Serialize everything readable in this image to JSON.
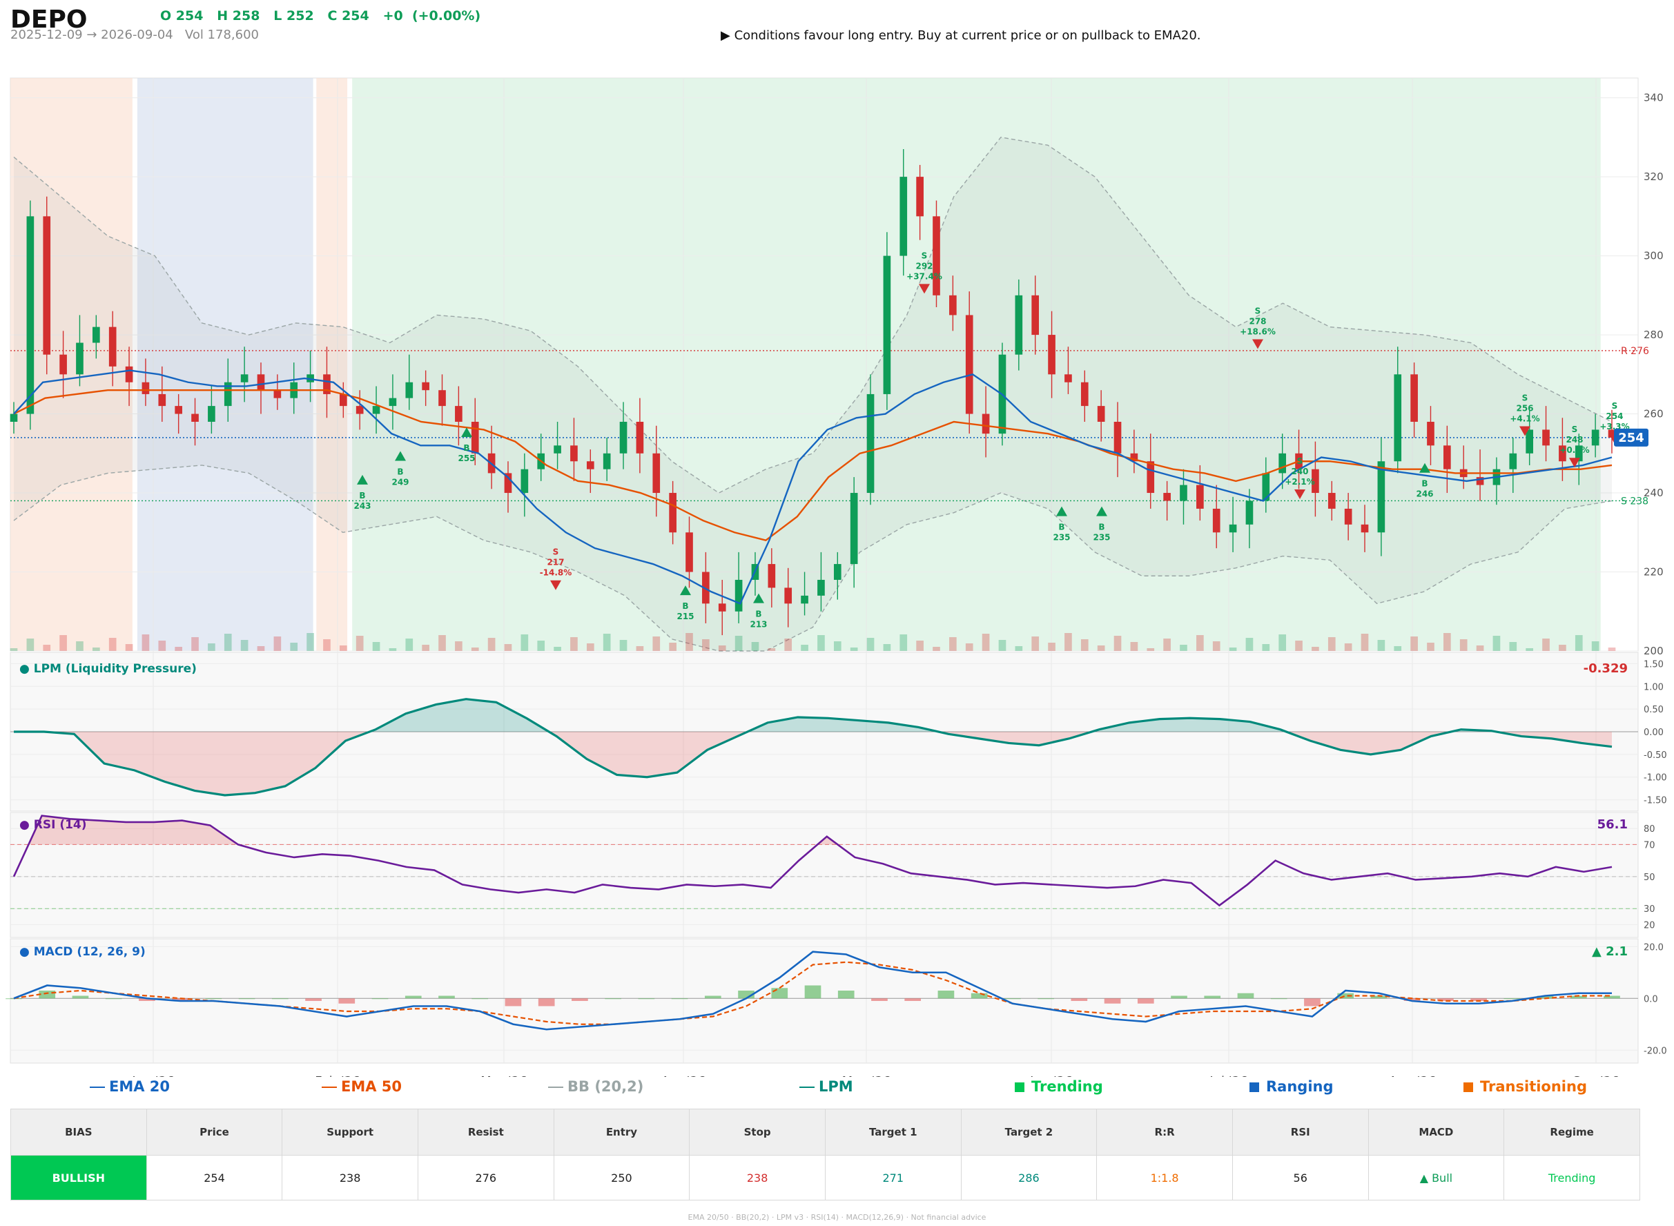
{
  "header": {
    "ticker": "DEPO",
    "ohlc": "O 254   H 258   L 252   C 254   +0  (+0.00%)",
    "range": "2025-12-09 → 2026-09-04   Vol 178,600",
    "note": "▶  Conditions favour long entry. Buy at current price or on pullback to EMA20."
  },
  "colors": {
    "up": "#0f9d58",
    "down": "#d32f2f",
    "ema20": "#1565c0",
    "ema50": "#e65100",
    "bb": "#9aa5a5",
    "lpm": "#00897b",
    "rsi": "#6a1b9a",
    "macd": "#1565c0",
    "signal": "#e65100",
    "trending": "#00c853",
    "ranging": "#1565c0",
    "transitioning": "#ef6c00"
  },
  "chart_data": {
    "type": "line",
    "title": "DEPO",
    "x_start": "2025-12-09",
    "x_end": "2026-09-04",
    "x_ticks": [
      "Jan '26",
      "Feb '26",
      "Mar '26",
      "Apr '26",
      "May '26",
      "Jun '26",
      "Jul '26",
      "Aug '26",
      "Sep '26"
    ],
    "price": {
      "ylim": [
        200,
        345
      ],
      "y_ticks": [
        200,
        220,
        240,
        260,
        280,
        300,
        320,
        340
      ],
      "last": "254",
      "resistance": {
        "value": 276,
        "label": "R 276"
      },
      "support": {
        "value": 238,
        "label": "S 238"
      },
      "price_line": 254,
      "closes": [
        260,
        310,
        275,
        270,
        278,
        282,
        272,
        268,
        265,
        262,
        260,
        258,
        262,
        268,
        270,
        266,
        264,
        268,
        270,
        265,
        262,
        260,
        262,
        264,
        268,
        266,
        262,
        258,
        250,
        245,
        240,
        246,
        250,
        252,
        248,
        246,
        250,
        258,
        250,
        240,
        230,
        220,
        212,
        210,
        218,
        222,
        216,
        212,
        214,
        218,
        222,
        240,
        265,
        300,
        320,
        310,
        290,
        285,
        260,
        255,
        275,
        290,
        280,
        270,
        268,
        262,
        258,
        250,
        248,
        240,
        238,
        242,
        236,
        230,
        232,
        238,
        245,
        250,
        246,
        240,
        236,
        232,
        230,
        248,
        270,
        258,
        252,
        246,
        244,
        242,
        246,
        250,
        256,
        252,
        248,
        252,
        256,
        254
      ],
      "ema20": [
        260,
        268,
        269,
        270,
        271,
        270,
        268,
        267,
        267,
        268,
        269,
        268,
        262,
        255,
        252,
        252,
        250,
        244,
        236,
        230,
        226,
        224,
        222,
        219,
        215,
        212,
        228,
        248,
        256,
        259,
        260,
        265,
        268,
        270,
        265,
        258,
        255,
        252,
        250,
        246,
        244,
        242,
        240,
        238,
        245,
        249,
        248,
        246,
        245,
        244,
        243,
        244,
        245,
        246,
        247,
        249
      ],
      "ema50": [
        260,
        264,
        265,
        266,
        266,
        266,
        266,
        266,
        266,
        266,
        266,
        264,
        261,
        258,
        257,
        256,
        253,
        247,
        243,
        242,
        240,
        237,
        233,
        230,
        228,
        234,
        244,
        250,
        252,
        255,
        258,
        257,
        256,
        255,
        253,
        250,
        248,
        246,
        245,
        243,
        245,
        248,
        248,
        247,
        246,
        246,
        245,
        245,
        245,
        246,
        246,
        247
      ],
      "bb_upper": [
        325,
        315,
        305,
        300,
        283,
        280,
        283,
        282,
        278,
        285,
        284,
        281,
        272,
        260,
        248,
        240,
        246,
        250,
        265,
        285,
        315,
        330,
        328,
        320,
        305,
        290,
        282,
        288,
        282,
        281,
        280,
        278,
        270,
        264,
        258
      ],
      "bb_lower": [
        233,
        242,
        245,
        246,
        247,
        245,
        238,
        230,
        232,
        234,
        228,
        225,
        220,
        214,
        203,
        200,
        200,
        206,
        225,
        232,
        235,
        240,
        236,
        225,
        219,
        219,
        221,
        224,
        223,
        212,
        215,
        222,
        225,
        236,
        238
      ],
      "signals": [
        {
          "side": "B",
          "price": 243,
          "label": "B\n243"
        },
        {
          "side": "B",
          "price": 249,
          "label": "B\n249"
        },
        {
          "side": "B",
          "price": 255,
          "label": "B\n255"
        },
        {
          "side": "S",
          "price": 217,
          "label": "S\n217\n-14.8%"
        },
        {
          "side": "B",
          "price": 215,
          "label": "B\n215"
        },
        {
          "side": "B",
          "price": 213,
          "label": "B\n213"
        },
        {
          "side": "S",
          "price": 292,
          "label": "S\n292\n+37.4%"
        },
        {
          "side": "B",
          "price": 235,
          "label": "B\n235"
        },
        {
          "side": "B",
          "price": 235,
          "label": "B\n235"
        },
        {
          "side": "S",
          "price": 278,
          "label": "S\n278\n+18.6%"
        },
        {
          "side": "S",
          "price": 240,
          "label": "S\n240\n+2.1%"
        },
        {
          "side": "B",
          "price": 246,
          "label": "B\n246"
        },
        {
          "side": "S",
          "price": 256,
          "label": "S\n256\n+4.1%"
        },
        {
          "side": "S",
          "price": 248,
          "label": "S\n248\n+0.8%"
        },
        {
          "side": "S",
          "price": 254,
          "label": "S\n254\n+3.3%"
        }
      ],
      "regimes": [
        {
          "from": 0,
          "to": 0.075,
          "regime": "Transitioning"
        },
        {
          "from": 0.078,
          "to": 0.186,
          "regime": "Ranging"
        },
        {
          "from": 0.188,
          "to": 0.207,
          "regime": "Transitioning"
        },
        {
          "from": 0.21,
          "to": 0.977,
          "regime": "Trending"
        }
      ]
    },
    "lpm": {
      "title": "● LPM (Liquidity Pressure)",
      "last": "-0.329",
      "ylim": [
        -1.75,
        1.75
      ],
      "y_ticks": [
        "1.50",
        "1.00",
        "0.50",
        "0.00",
        "-0.50",
        "-1.00",
        "-1.50"
      ],
      "values": [
        0.0,
        0.0,
        -0.05,
        -0.7,
        -0.85,
        -1.1,
        -1.3,
        -1.4,
        -1.35,
        -1.2,
        -0.8,
        -0.2,
        0.05,
        0.4,
        0.6,
        0.72,
        0.65,
        0.3,
        -0.1,
        -0.6,
        -0.95,
        -1.0,
        -0.9,
        -0.4,
        -0.1,
        0.2,
        0.32,
        0.3,
        0.25,
        0.2,
        0.1,
        -0.05,
        -0.15,
        -0.25,
        -0.3,
        -0.15,
        0.05,
        0.2,
        0.28,
        0.3,
        0.28,
        0.22,
        0.05,
        -0.2,
        -0.4,
        -0.5,
        -0.4,
        -0.1,
        0.05,
        0.02,
        -0.1,
        -0.15,
        -0.25,
        -0.33
      ]
    },
    "rsi": {
      "title": "● RSI (14)",
      "last": "56.1",
      "ylim": [
        12,
        90
      ],
      "y_ticks": [
        "80",
        "70",
        "50",
        "30",
        "20"
      ],
      "values": [
        50,
        88,
        86,
        85,
        84,
        84,
        85,
        82,
        70,
        65,
        62,
        64,
        63,
        60,
        56,
        54,
        45,
        42,
        40,
        42,
        40,
        45,
        43,
        42,
        45,
        44,
        45,
        43,
        60,
        75,
        62,
        58,
        52,
        50,
        48,
        45,
        46,
        45,
        44,
        43,
        44,
        48,
        46,
        32,
        45,
        60,
        52,
        48,
        50,
        52,
        48,
        49,
        50,
        52,
        50,
        56,
        53,
        56
      ]
    },
    "macd": {
      "title": "● MACD (12, 26, 9)",
      "last": "▲ 2.1",
      "ylim": [
        -25,
        23
      ],
      "y_ticks": [
        "20.0",
        "0.0",
        "-20.0"
      ],
      "macd": [
        0,
        5,
        4,
        2,
        0,
        -1,
        -1,
        -2,
        -3,
        -5,
        -7,
        -5,
        -3,
        -3,
        -5,
        -10,
        -12,
        -11,
        -10,
        -9,
        -8,
        -6,
        0,
        8,
        18,
        17,
        12,
        10,
        10,
        4,
        -2,
        -4,
        -6,
        -8,
        -9,
        -5,
        -4,
        -3,
        -5,
        -7,
        3,
        2,
        -1,
        -2,
        -2,
        -1,
        1,
        2,
        2
      ],
      "signal": [
        0,
        2,
        3,
        2,
        1,
        0,
        -1,
        -2,
        -3,
        -4,
        -5,
        -5,
        -4,
        -4,
        -5,
        -7,
        -9,
        -10,
        -10,
        -9,
        -8,
        -7,
        -3,
        4,
        13,
        14,
        13,
        11,
        7,
        2,
        -2,
        -4,
        -5,
        -6,
        -7,
        -6,
        -5,
        -5,
        -5,
        -4,
        1,
        1,
        0,
        -1,
        -1,
        -1,
        0,
        1,
        1
      ]
    }
  },
  "legend": {
    "ema20": "EMA 20",
    "ema50": "EMA 50",
    "bb": "BB (20,2)",
    "lpm": "LPM",
    "trending": "Trending",
    "ranging": "Ranging",
    "transitioning": "Transitioning"
  },
  "summary": {
    "headers": [
      "BIAS",
      "Price",
      "Support",
      "Resist",
      "Entry",
      "Stop",
      "Target 1",
      "Target 2",
      "R:R",
      "RSI",
      "MACD",
      "Regime"
    ],
    "values": [
      "BULLISH",
      "254",
      "238",
      "276",
      "250",
      "238",
      "271",
      "286",
      "1:1.8",
      "56",
      "▲ Bull",
      "Trending"
    ]
  },
  "footer": "EMA 20/50  ·  BB(20,2)  ·  LPM v3  ·  RSI(14)  ·  MACD(12,26,9)  ·  Not financial advice"
}
